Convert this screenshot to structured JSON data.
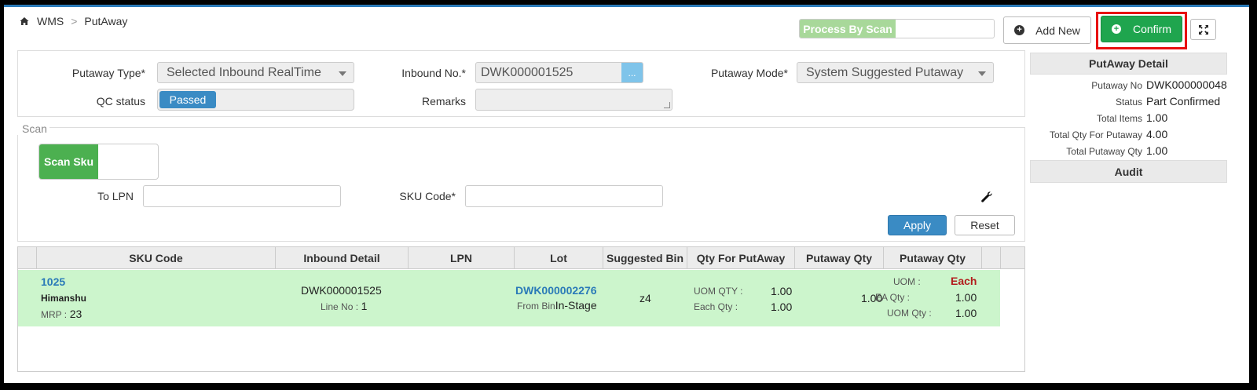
{
  "breadcrumb": {
    "home_icon": "home-icon",
    "module": "WMS",
    "separator": ">",
    "page": "PutAway"
  },
  "toolbar": {
    "process_by_scan": "Process By Scan",
    "add_new": "Add New",
    "confirm": "Confirm",
    "expand_icon": "expand-icon",
    "confirm_color": "#1fa54e",
    "highlight_color": "#e81010"
  },
  "form": {
    "putaway_type_label": "Putaway Type*",
    "putaway_type_value": "Selected Inbound RealTime",
    "inbound_no_label": "Inbound No.*",
    "inbound_no_value": "DWK000001525",
    "inbound_lookup": "...",
    "putaway_mode_label": "Putaway Mode*",
    "putaway_mode_value": "System Suggested Putaway",
    "qc_status_label": "QC status",
    "qc_status_value": "Passed",
    "remarks_label": "Remarks",
    "remarks_value": ""
  },
  "detail": {
    "title": "PutAway Detail",
    "rows": [
      {
        "label": "Putaway No",
        "value": "DWK000000048"
      },
      {
        "label": "Status",
        "value": "Part Confirmed"
      },
      {
        "label": "Total Items",
        "value": "1.00"
      },
      {
        "label": "Total Qty For Putaway",
        "value": "4.00"
      },
      {
        "label": "Total Putaway Qty",
        "value": "1.00"
      }
    ],
    "audit_title": "Audit"
  },
  "scan": {
    "legend": "Scan",
    "scan_sku": "Scan Sku",
    "to_lpn_label": "To LPN",
    "to_lpn_value": "",
    "sku_code_label": "SKU Code*",
    "sku_code_value": "",
    "settings_icon": "wrench-icon",
    "apply": "Apply",
    "reset": "Reset"
  },
  "table": {
    "headers": [
      "SKU Code",
      "Inbound Detail",
      "LPN",
      "Lot",
      "Suggested Bin",
      "Qty For PutAway",
      "Putaway Qty",
      "Putaway Qty"
    ],
    "row": {
      "sku_code": "1025",
      "sku_name": "Himanshu",
      "mrp_label": "MRP :",
      "mrp_value": "23",
      "inbound_no": "DWK000001525",
      "line_no_label": "Line No :",
      "line_no_value": "1",
      "lpn": "",
      "lot": "DWK000002276",
      "from_bin_label": "From Bin",
      "from_bin_value": "In-Stage",
      "suggested_bin": "z4",
      "uom_qty_label": "UOM QTY :",
      "uom_qty_value": "1.00",
      "each_qty_label": "Each Qty :",
      "each_qty_value": "1.00",
      "putaway_qty": "1.00",
      "uom_label": "UOM :",
      "uom_value": "Each",
      "ea_qty_label": "EA Qty :",
      "ea_qty_value": "1.00",
      "uom_qty2_label": "UOM Qty :",
      "uom_qty2_value": "1.00",
      "row_color": "#ccf5cc"
    }
  }
}
